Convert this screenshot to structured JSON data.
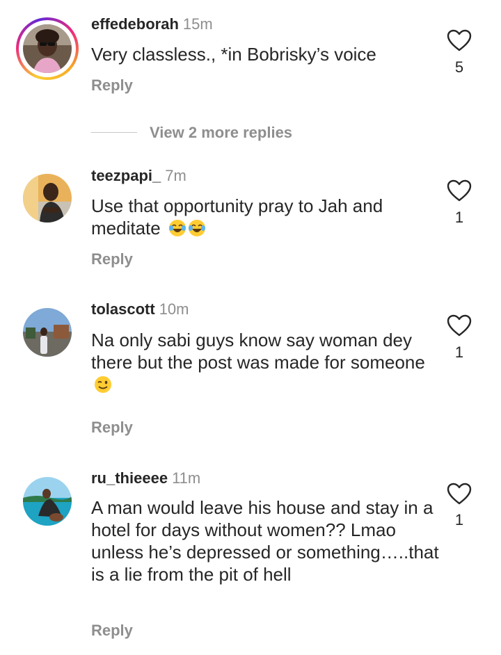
{
  "comments": [
    {
      "username": "effedeborah",
      "time": "15m",
      "text": "Very classless., *in Bobrisky’s voice",
      "reply": "Reply",
      "likes": "5",
      "has_story": true,
      "emojis": []
    },
    {
      "username": "teezpapi_",
      "time": "7m",
      "text": "Use that opportunity pray to Jah and meditate",
      "reply": "Reply",
      "likes": "1",
      "has_story": false,
      "emojis": [
        "face-with-tears-of-joy",
        "face-with-tears-of-joy"
      ]
    },
    {
      "username": "tolascott",
      "time": "10m",
      "text": "Na only sabi guys know say woman dey there but the post was made for someone",
      "reply": "Reply",
      "likes": "1",
      "has_story": false,
      "emojis": [
        "winking-face"
      ]
    },
    {
      "username": "ru_thieeee",
      "time": "11m",
      "text": "A man would leave his house and stay in a hotel for days without women?? Lmao unless he’s depressed or something…..that is a lie from the pit of hell",
      "reply": "Reply",
      "likes": "1",
      "has_story": false,
      "emojis": []
    }
  ],
  "view_more_replies": "View 2 more replies",
  "colors": {
    "text": "#262626",
    "secondary": "#8e8e8e",
    "divider": "#c7c7c7",
    "story_ring_start": "#f9ce34",
    "story_ring_mid": "#ee2a7b"
  },
  "icons": {
    "like": "heart-outline-icon"
  }
}
